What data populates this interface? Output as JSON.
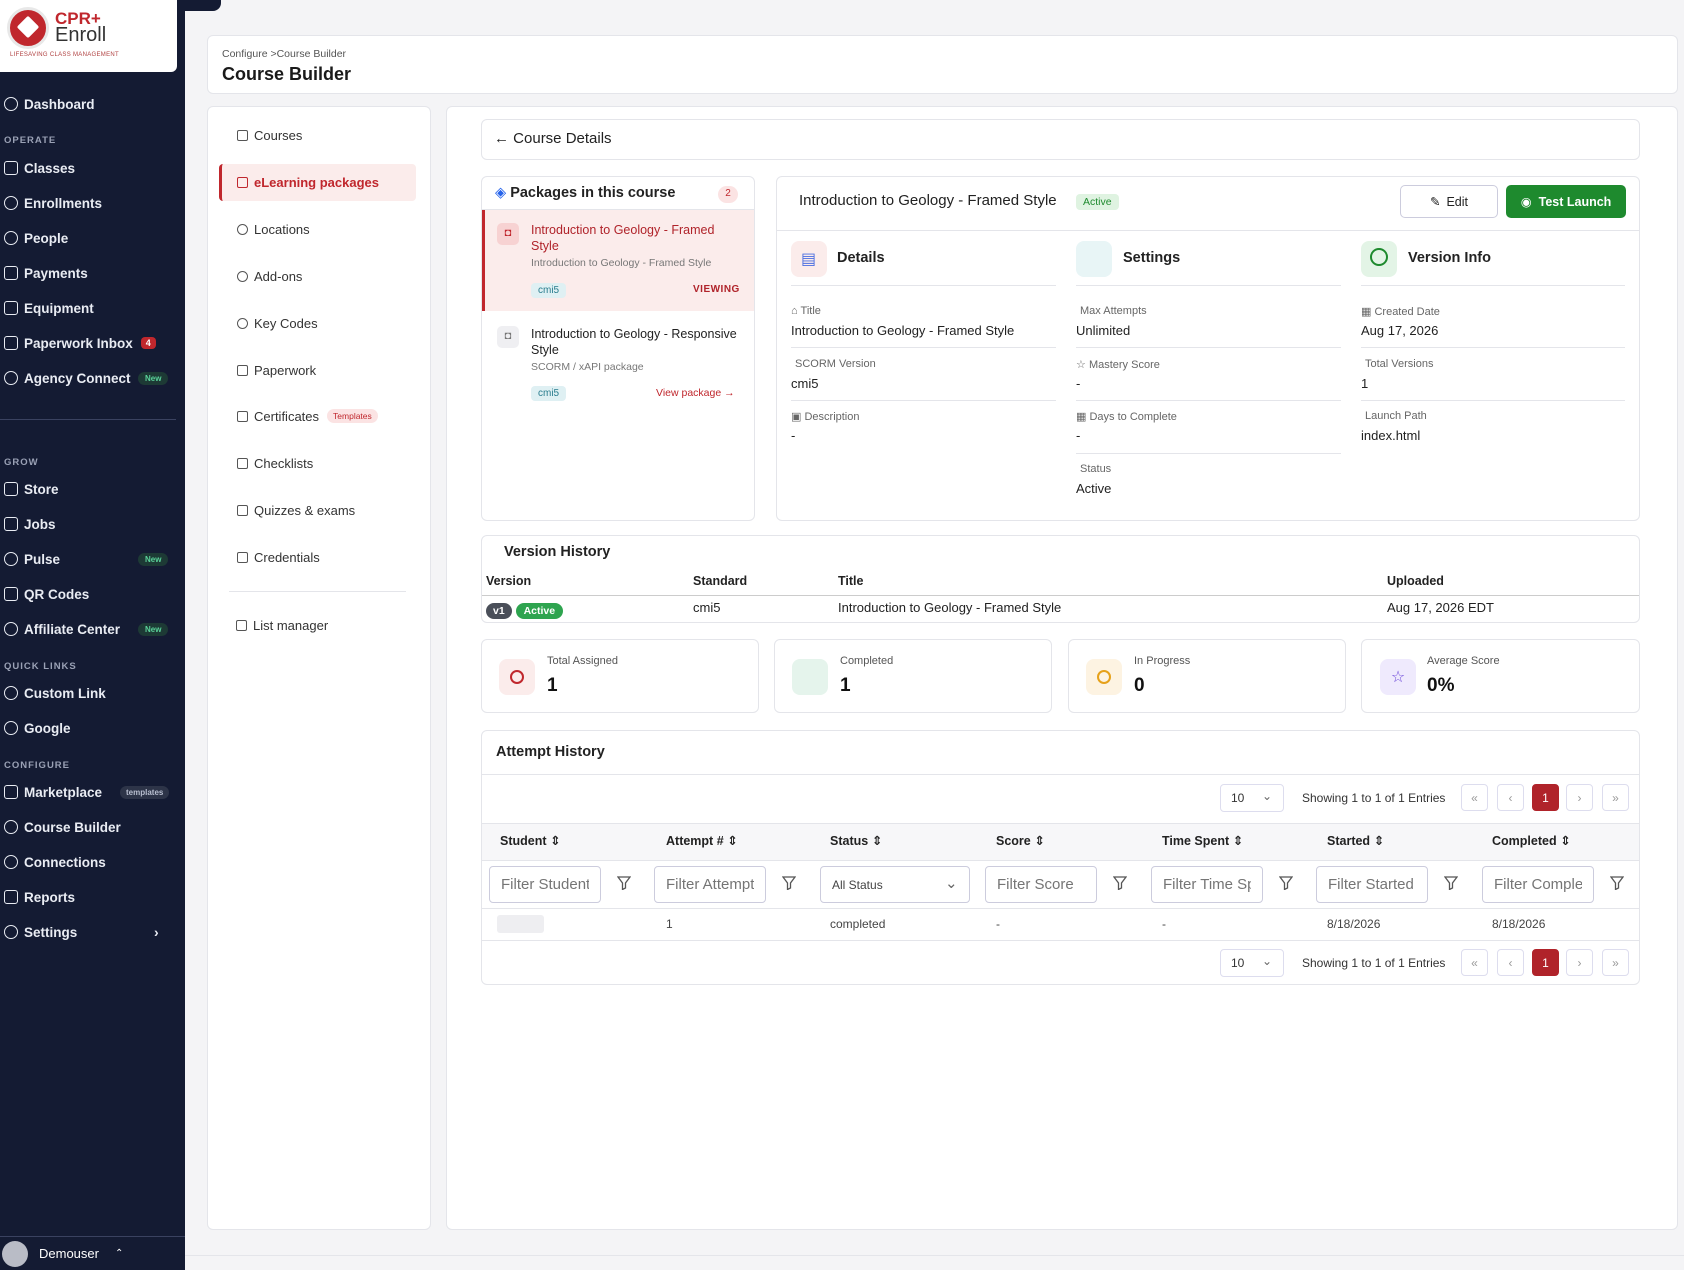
{
  "brand": {
    "line1": "CPR+",
    "line2": "Enroll",
    "tagline": "LIFESAVING CLASS MANAGEMENT"
  },
  "sidebar": {
    "dashboard": "Dashboard",
    "sections": {
      "operate": "OPERATE",
      "grow": "GROW",
      "quick_links": "QUICK LINKS",
      "configure": "CONFIGURE"
    },
    "operate": [
      {
        "label": "Classes"
      },
      {
        "label": "Enrollments"
      },
      {
        "label": "People"
      },
      {
        "label": "Payments"
      },
      {
        "label": "Equipment"
      },
      {
        "label": "Paperwork Inbox",
        "badge": "4"
      },
      {
        "label": "Agency Connect",
        "tag": "New"
      }
    ],
    "grow": [
      {
        "label": "Store"
      },
      {
        "label": "Jobs"
      },
      {
        "label": "Pulse",
        "tag": "New"
      },
      {
        "label": "QR Codes"
      },
      {
        "label": "Affiliate Center",
        "tag": "New"
      }
    ],
    "quick_links": [
      {
        "label": "Custom Link"
      },
      {
        "label": "Google"
      }
    ],
    "configure": [
      {
        "label": "Marketplace",
        "tag": "templates"
      },
      {
        "label": "Course Builder"
      },
      {
        "label": "Connections"
      },
      {
        "label": "Reports"
      },
      {
        "label": "Settings"
      }
    ],
    "user": "Demouser"
  },
  "header": {
    "crumb_parent": "Configure",
    "crumb_current": "Course Builder",
    "title": "Course Builder"
  },
  "submenu": {
    "items": [
      "Courses",
      "eLearning packages",
      "Locations",
      "Add-ons",
      "Key Codes",
      "Paperwork",
      "Certificates",
      "Checklists",
      "Quizzes & exams",
      "Credentials",
      "List manager"
    ],
    "certificates_tag": "Templates"
  },
  "back": {
    "label": "Course Details"
  },
  "packages": {
    "title": "Packages in this course",
    "count": "2",
    "items": [
      {
        "title": "Introduction to Geology - Framed Style",
        "subtitle": "Introduction to Geology - Framed Style",
        "tag": "cmi5",
        "status": "VIEWING"
      },
      {
        "title": "Introduction to Geology - Responsive Style",
        "subtitle": "SCORM / xAPI package",
        "tag": "cmi5",
        "action": "View package →"
      }
    ]
  },
  "detail": {
    "title": "Introduction to Geology - Framed Style",
    "status": "Active",
    "edit": "Edit",
    "launch": "Test Launch",
    "details": {
      "heading": "Details",
      "title_label": "Title",
      "title_value": "Introduction to Geology - Framed Style",
      "scorm_label": "SCORM Version",
      "scorm_value": "cmi5",
      "desc_label": "Description",
      "desc_value": "-"
    },
    "settings": {
      "heading": "Settings",
      "max_label": "Max Attempts",
      "max_value": "Unlimited",
      "mastery_label": "Mastery Score",
      "mastery_value": "-",
      "days_label": "Days to Complete",
      "days_value": "-",
      "status_label": "Status",
      "status_value": "Active"
    },
    "version": {
      "heading": "Version Info",
      "created_label": "Created Date",
      "created_value": "Aug 17, 2026",
      "total_label": "Total Versions",
      "total_value": "1",
      "launch_label": "Launch Path",
      "launch_value": "index.html"
    }
  },
  "version_history": {
    "title": "Version History",
    "columns": [
      "Version",
      "Standard",
      "Title",
      "Uploaded"
    ],
    "rows": [
      {
        "version": "v1",
        "status": "Active",
        "standard": "cmi5",
        "title": "Introduction to Geology - Framed Style",
        "uploaded": "Aug 17, 2026 EDT"
      }
    ]
  },
  "stats": [
    {
      "label": "Total Assigned",
      "value": "1"
    },
    {
      "label": "Completed",
      "value": "1"
    },
    {
      "label": "In Progress",
      "value": "0"
    },
    {
      "label": "Average Score",
      "value": "0%"
    }
  ],
  "attempts": {
    "title": "Attempt History",
    "page_size": "10",
    "showing": "Showing 1 to 1 of 1 Entries",
    "page": "1",
    "columns": [
      "Student",
      "Attempt #",
      "Status",
      "Score",
      "Time Spent",
      "Started",
      "Completed"
    ],
    "filters": [
      "Filter Student",
      "Filter Attempt",
      "All Status",
      "Filter Score",
      "Filter Time Spent",
      "Filter Started",
      "Filter Completed"
    ],
    "rows": [
      {
        "attempt": "1",
        "status": "completed",
        "score": "-",
        "time": "-",
        "started": "8/18/2026",
        "completed": "8/18/2026"
      }
    ]
  },
  "colors": {
    "brand_red": "#c0272d",
    "sidebar_bg": "#141b33",
    "success": "#1e8a2e",
    "page_active": "#b0232a"
  }
}
